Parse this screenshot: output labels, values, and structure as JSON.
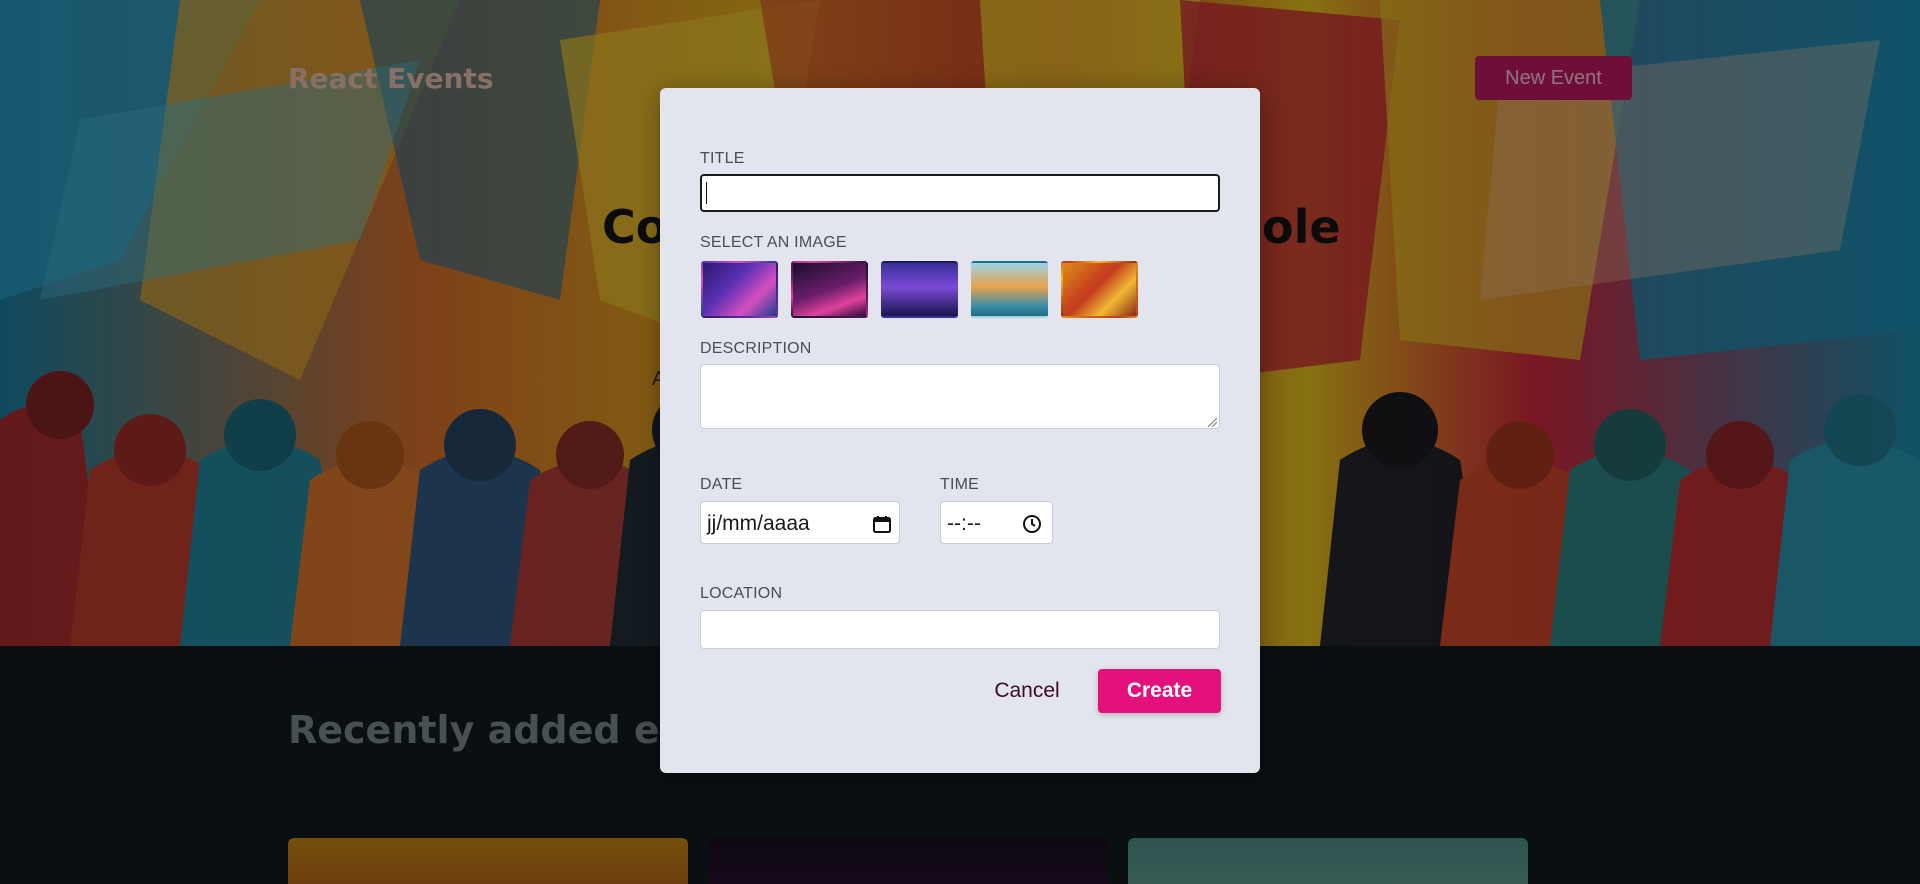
{
  "header": {
    "title": "React Events",
    "new_event_label": "New Event"
  },
  "hero": {
    "heading_visible_left": "Co",
    "heading_visible_right": "ole",
    "subtitle_visible_left": "A",
    "subtitle_visible_right": "!"
  },
  "recent": {
    "heading": "Recently added eve"
  },
  "modal": {
    "title_label": "TITLE",
    "title_value": "",
    "image_label": "SELECT AN IMAGE",
    "images": [
      {
        "name": "city-neon-image"
      },
      {
        "name": "studio-desk-image"
      },
      {
        "name": "concert-crowd-image"
      },
      {
        "name": "lake-city-image"
      },
      {
        "name": "women-laptop-image"
      }
    ],
    "description_label": "DESCRIPTION",
    "description_value": "",
    "date_label": "DATE",
    "date_placeholder": "jj/mm/aaaa",
    "time_label": "TIME",
    "time_placeholder": "--:--",
    "location_label": "LOCATION",
    "location_value": "",
    "cancel_label": "Cancel",
    "create_label": "Create"
  },
  "colors": {
    "accent": "#e4117c",
    "modal_bg": "#e2e5ee",
    "page_bg": "#121a1f"
  }
}
